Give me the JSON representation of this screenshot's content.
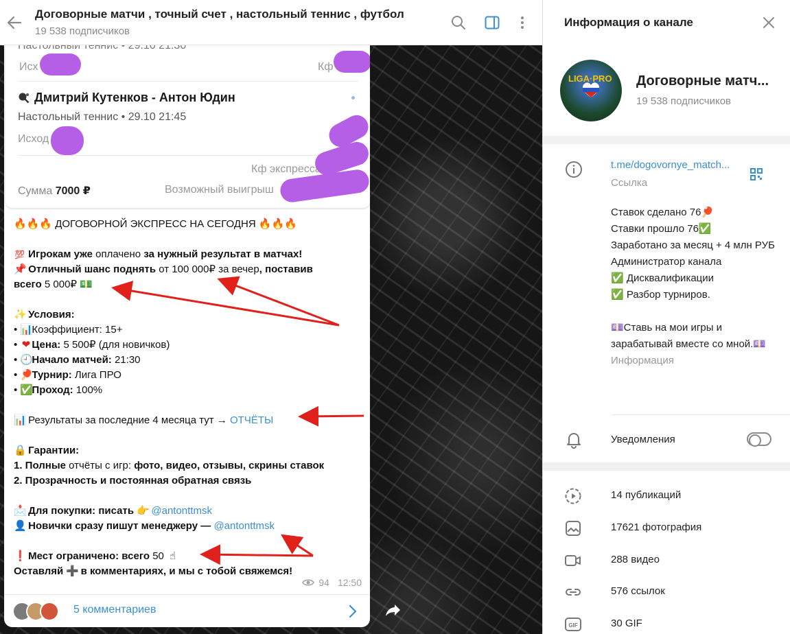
{
  "header": {
    "title": "Договорные матчи , точный счет , настольный теннис , футбол",
    "subtitle": "19 538 подписчиков"
  },
  "bet_card": {
    "clipped_top": "Настольный теннис • 29.10 21:30",
    "outcome_label_1": "Исх",
    "kf_label_1": "Кф",
    "match_title": "Дмитрий Кутенков - Антон Юдин",
    "sport_line": "Настольный теннис • 29.10 21:45",
    "outcome_label_2": "Исход",
    "express_label": "Кф экспресса",
    "sum_label": "Сумма",
    "sum_value": "7000 ₽",
    "win_label": "Возможный выигрыш"
  },
  "message": {
    "headline": "🔥🔥🔥 ДОГОВОРНОЙ ЭКСПРЕСС НА СЕГОДНЯ 🔥🔥🔥",
    "l1_a": "Игрокам уже",
    "l1_b": " оплачено ",
    "l1_c": "за нужный результат в матчах!",
    "l2_a": "Отличный шанс поднять",
    "l2_b": " от 100 000₽ за вечер",
    "l2_c": ", поставив",
    "l3_a": "всего",
    "l3_b": " 5 000₽ ",
    "cond_title": "Условия:",
    "c1_a": "Коэффициент:",
    "c1_b": " 15+",
    "c2_a": "Цена:",
    "c2_b": " 5 500₽ (для новичков)",
    "c3_a": "Начало матчей:",
    "c3_b": " 21:30",
    "c4_a": "Турнир:",
    "c4_b": " Лига ПРО",
    "c5_a": "Проход:",
    "c5_b": " 100%",
    "results_text": "Результаты за последние 4 месяца тут → ",
    "results_link": "ОТЧЁТЫ",
    "guar_title": "Гарантии:",
    "g1_a": "1. Полные",
    "g1_b": " отчёты с игр: ",
    "g1_c": "фото, видео, отзывы, скрины ставок",
    "g2": "2. Прозрачность и постоянная обратная связь",
    "buy_a": "Для покупки: писать",
    "buy_link": "@antonttmsk",
    "newbie_a": "Новички сразу пишут менеджеру — ",
    "newbie_link": "@antonttmsk",
    "limit_a": "Мест ограничено: всего",
    "limit_b": " 50 ",
    "leave_a": "Оставляй",
    "leave_b": " в комментариях, и мы с тобой свяжемся!",
    "views": "94",
    "time": "12:50",
    "comments": "5 комментариев"
  },
  "info_panel": {
    "title": "Информация о канале",
    "channel_name": "Договорные матч...",
    "subscribers": "19 538 подписчиков",
    "link": "t.me/dogovornye_match...",
    "link_caption": "Ссылка",
    "desc_1": "Ставок сделано 76🏓",
    "desc_2": "Ставки прошло  76✅",
    "desc_3": "     Заработано за месяц + 4 млн РУБ",
    "desc_4": "Администратор канала",
    "desc_5": "✅ Дисквалификации",
    "desc_6": "✅ Разбор турниров.",
    "desc_7": "💷Ставь на мои игры и зарабатывай вместе со мной.💷",
    "desc_caption": "Информация",
    "notifications": "Уведомления",
    "stats": [
      {
        "label": "14 публикаций",
        "icon": "video-message-icon"
      },
      {
        "label": "17621 фотография",
        "icon": "photo-icon"
      },
      {
        "label": "288 видео",
        "icon": "video-icon"
      },
      {
        "label": "576 ссылок",
        "icon": "link-icon"
      },
      {
        "label": "30 GIF",
        "icon": "gif-icon"
      }
    ]
  },
  "colors": {
    "accent": "#3a8fd6",
    "redaction": "#b55ee6",
    "arrow": "#e0201a"
  }
}
